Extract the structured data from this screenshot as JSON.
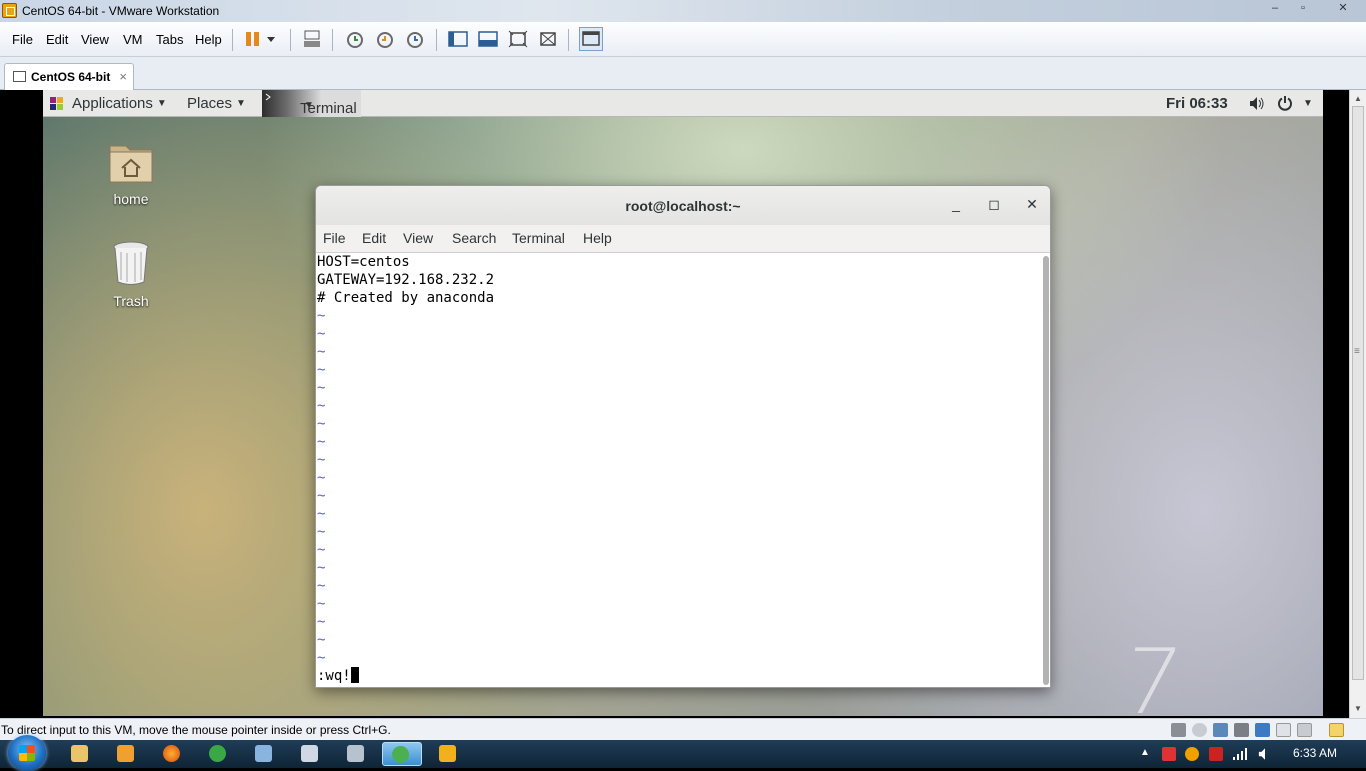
{
  "window": {
    "title": "CentOS 64-bit - VMware Workstation",
    "controls": [
      "–",
      "▫",
      "✕"
    ]
  },
  "menubar": {
    "items": [
      "File",
      "Edit",
      "View",
      "VM",
      "Tabs",
      "Help"
    ]
  },
  "tab": {
    "label": "CentOS 64-bit",
    "close": "×"
  },
  "guest": {
    "panel": {
      "applications": "Applications",
      "places": "Places",
      "terminal_task": "Terminal",
      "clock": "Fri 06:33"
    },
    "desktop": {
      "home_label": "home",
      "trash_label": "Trash"
    },
    "terminal": {
      "title": "root@localhost:~",
      "menus": [
        "File",
        "Edit",
        "View",
        "Search",
        "Terminal",
        "Help"
      ],
      "lines": [
        "HOST=centos",
        "GATEWAY=192.168.232.2",
        "# Created by anaconda"
      ],
      "tilde": "~",
      "tilde_count": 20,
      "command": ":wq!"
    },
    "watermark": "7"
  },
  "statusbar": {
    "message": "To direct input to this VM, move the mouse pointer inside or press Ctrl+G."
  },
  "taskbar": {
    "clock": "6:33 AM"
  }
}
